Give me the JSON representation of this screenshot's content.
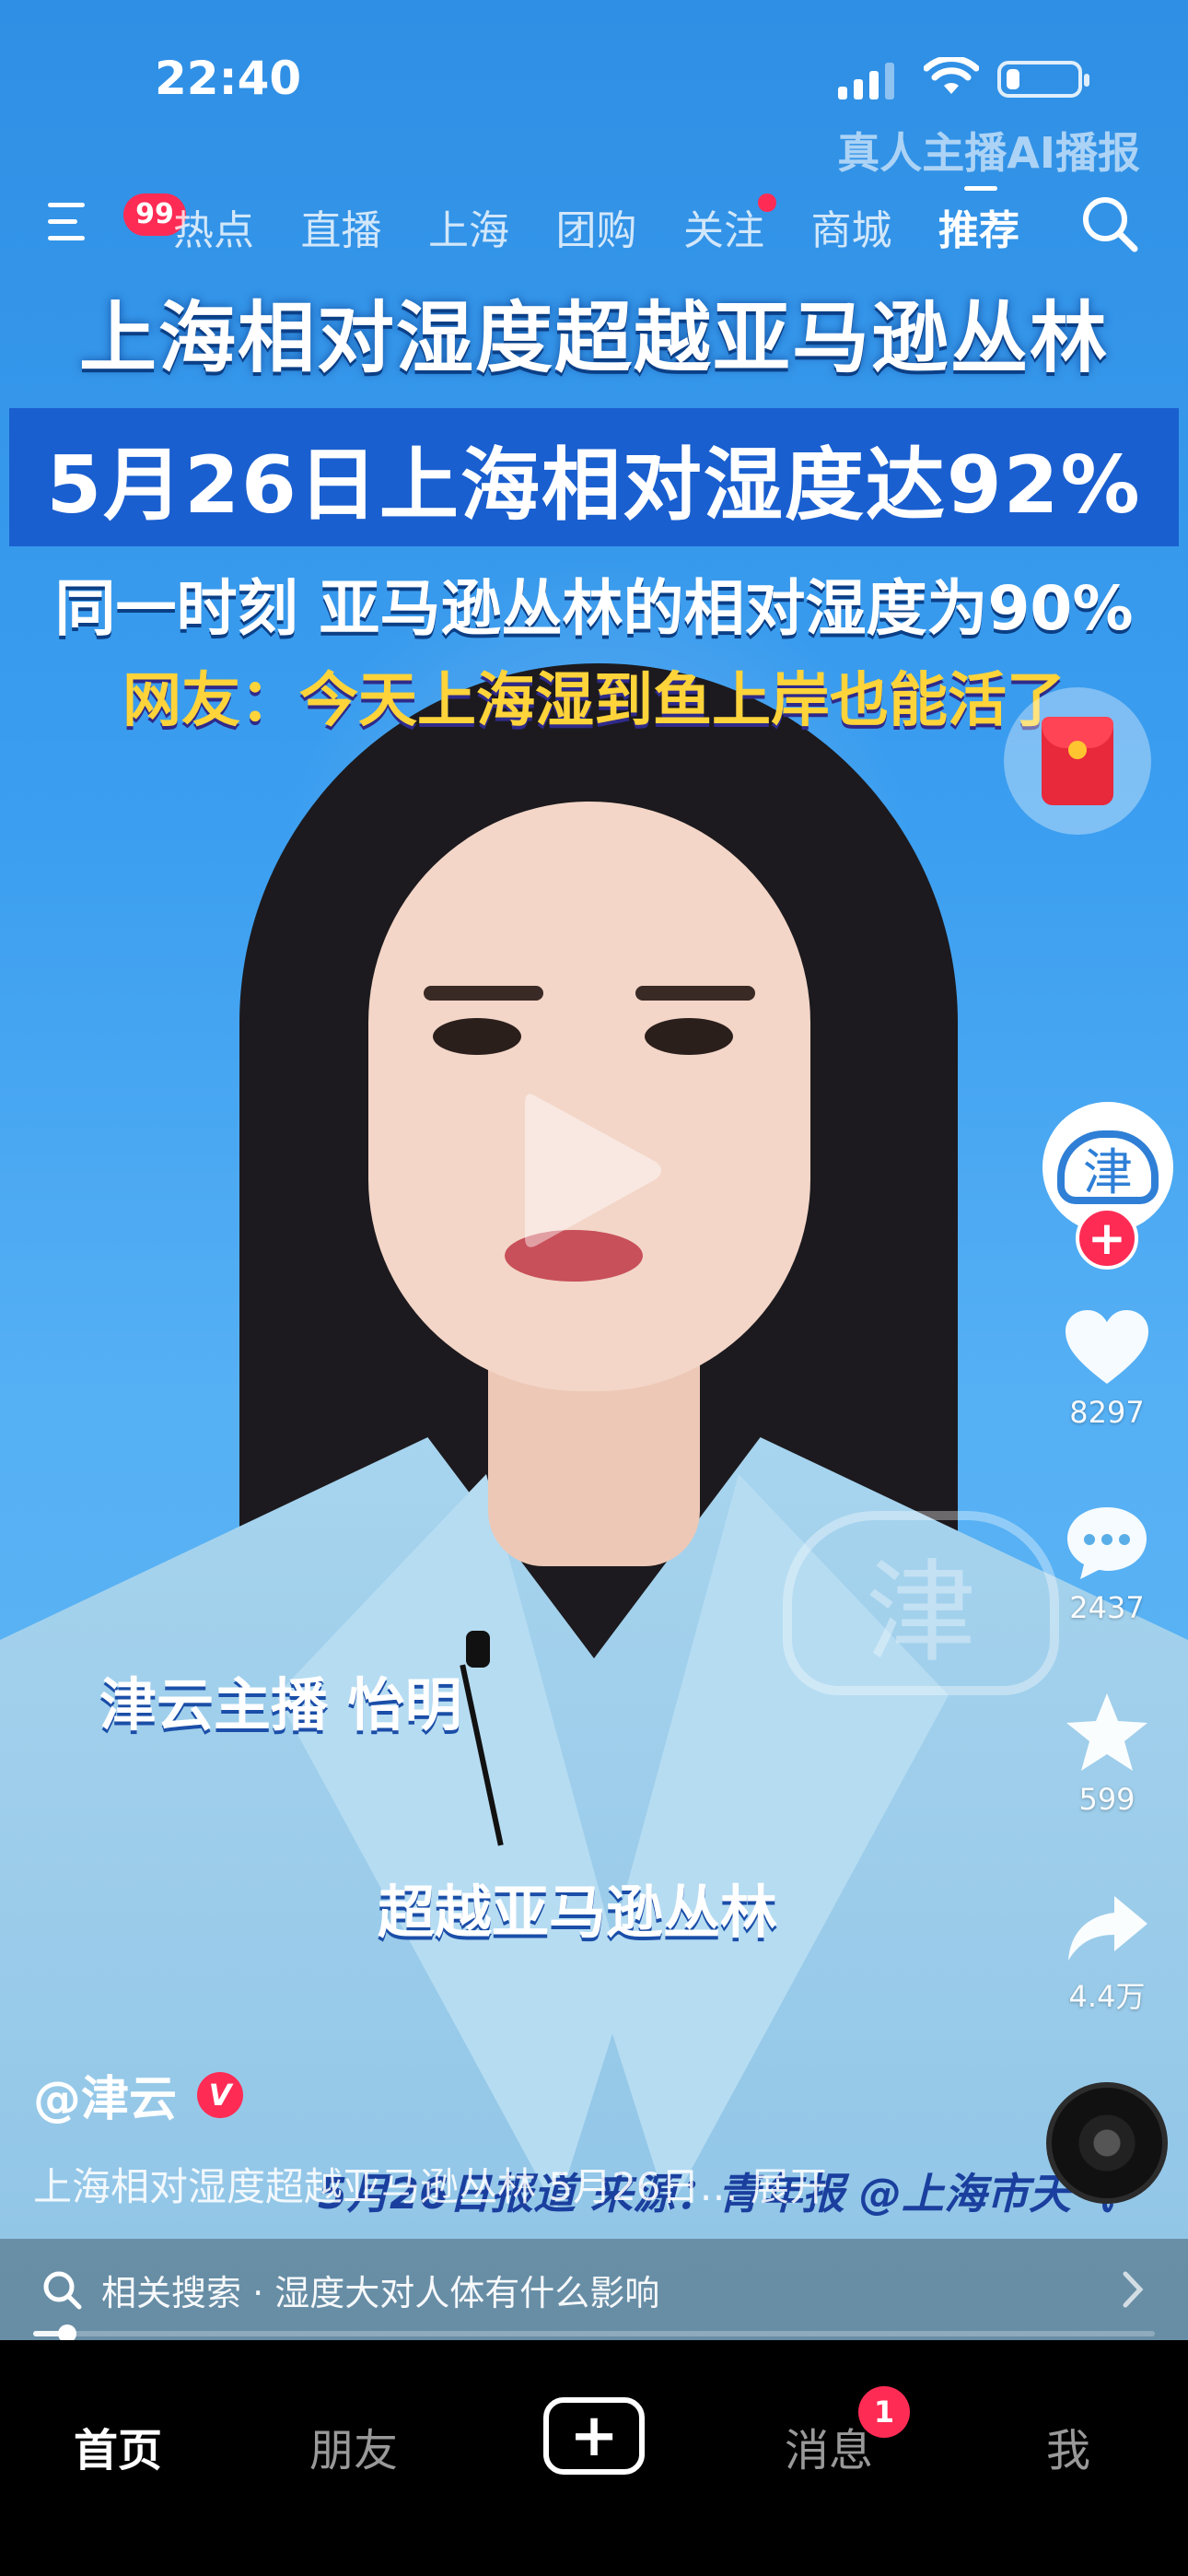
{
  "status_bar": {
    "time": "22:40",
    "signal_icon": "cellular-signal-icon",
    "wifi_icon": "wifi-icon",
    "battery_icon": "battery-icon",
    "battery_level": 0.2
  },
  "ai_tag": "真人主播AI播报",
  "top_nav": {
    "menu_icon": "menu-icon",
    "menu_badge": "99",
    "tabs": [
      {
        "label": "热点"
      },
      {
        "label": "直播"
      },
      {
        "label": "上海"
      },
      {
        "label": "团购"
      },
      {
        "label": "关注"
      },
      {
        "label": "商城"
      },
      {
        "label": "推荐"
      }
    ],
    "active_tab": "推荐",
    "search_icon": "search-icon"
  },
  "video": {
    "headline": {
      "line1": "上海相对湿度超越亚马逊丛林",
      "line2": "5月26日上海相对湿度达92%",
      "line3": "同一时刻 亚马逊丛林的相对湿度为90%",
      "line4": "网友：今天上海湿到鱼上岸也能活了"
    },
    "caption_name": "津云主播 怡明",
    "caption_mid": "超越亚马逊丛林",
    "caption_source": "5月26日报道 来源：青年报 @上海市天气",
    "watermark": "津",
    "play_icon": "play-icon"
  },
  "actions": {
    "red_packet_icon": "red-packet-icon",
    "avatar_text": "津",
    "follow_icon": "plus-icon",
    "like": {
      "icon": "heart-icon",
      "count": "8297"
    },
    "comment": {
      "icon": "comment-icon",
      "count": "2437"
    },
    "favorite": {
      "icon": "star-icon",
      "count": "599"
    },
    "share": {
      "icon": "share-icon",
      "count": "4.4万"
    },
    "music_icon": "music-disc-icon"
  },
  "post": {
    "author": "@津云",
    "verified_badge": "V",
    "description": "上海相对湿度超越亚马逊丛林 5月26日… 展开"
  },
  "related_search": {
    "label": "相关搜索 · 湿度大对人体有什么影响",
    "chevron_icon": "chevron-right-icon"
  },
  "progress": 0.03,
  "bottom_tabs": {
    "home": "首页",
    "friends": "朋友",
    "create": "+",
    "messages": "消息",
    "messages_badge": "1",
    "me": "我"
  },
  "colors": {
    "accent": "#fe2c55",
    "headline_band": "#1a5fcf",
    "highlight_text": "#ffd43a"
  }
}
